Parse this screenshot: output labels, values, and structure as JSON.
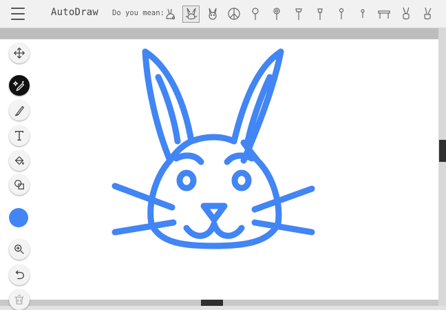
{
  "app": {
    "title": "AutoDraw"
  },
  "header": {
    "menu_icon": "hamburger-menu-icon",
    "suggestion_label": "Do you mean:",
    "suggestions": [
      "rabbit-sitting",
      "rabbit-head",
      "rabbit-face",
      "peace-sign",
      "lollipop",
      "lollipop-swirl",
      "push-pin",
      "pin",
      "pin-small",
      "pin-round",
      "table",
      "victory-hand",
      "victory-hand-outline"
    ],
    "selected_suggestion": "rabbit-head"
  },
  "tools": [
    {
      "name": "move",
      "icon": "move-arrows-icon"
    },
    {
      "name": "autodraw",
      "icon": "autodraw-sparkle-pen-icon",
      "active": true
    },
    {
      "name": "draw",
      "icon": "pencil-icon"
    },
    {
      "name": "type",
      "icon": "text-icon"
    },
    {
      "name": "fill",
      "icon": "paint-bucket-icon"
    },
    {
      "name": "shape",
      "icon": "shapes-icon"
    },
    {
      "name": "color",
      "icon": "color-swatch",
      "value": "#4285f4"
    },
    {
      "name": "zoom",
      "icon": "zoom-in-icon"
    },
    {
      "name": "undo",
      "icon": "undo-icon"
    },
    {
      "name": "delete",
      "icon": "trash-icon"
    }
  ],
  "colors": {
    "stroke": "#4285f4",
    "active_tool": "#111111",
    "topbar": "#f1f1f1"
  }
}
